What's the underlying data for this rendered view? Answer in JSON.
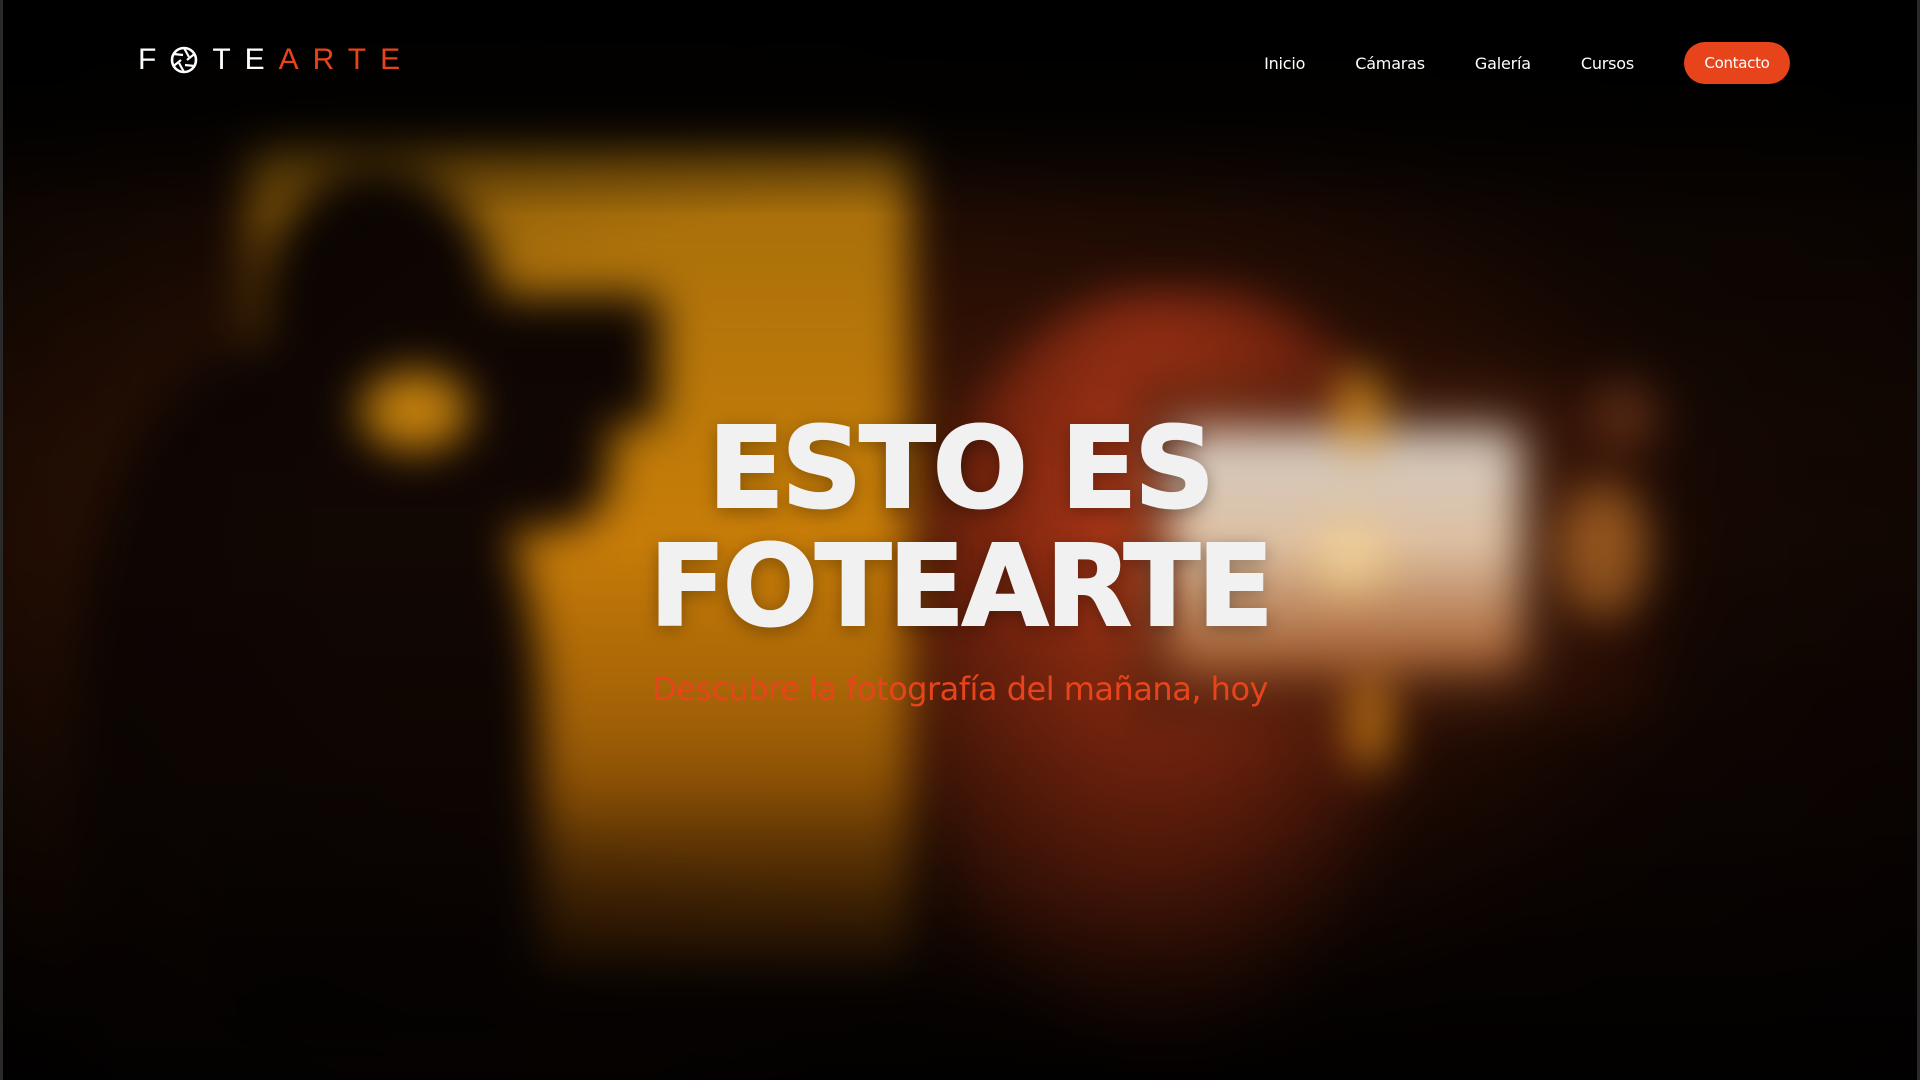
{
  "brand": {
    "logo_part1": "F",
    "logo_part2": "TE",
    "logo_part3": "ARTE",
    "accent_color": "#e8441c",
    "text_color": "#ffffff"
  },
  "nav": {
    "items": [
      {
        "label": "Inicio"
      },
      {
        "label": "Cámaras"
      },
      {
        "label": "Galería"
      },
      {
        "label": "Cursos"
      }
    ],
    "contact_label": "Contacto"
  },
  "hero": {
    "title_line1": "ESTO ES",
    "title_line2": "FOTEARTE",
    "subtitle": "Descubre la fotografía del mañana, hoy"
  },
  "icons": {
    "logo_o": "aperture-icon"
  }
}
